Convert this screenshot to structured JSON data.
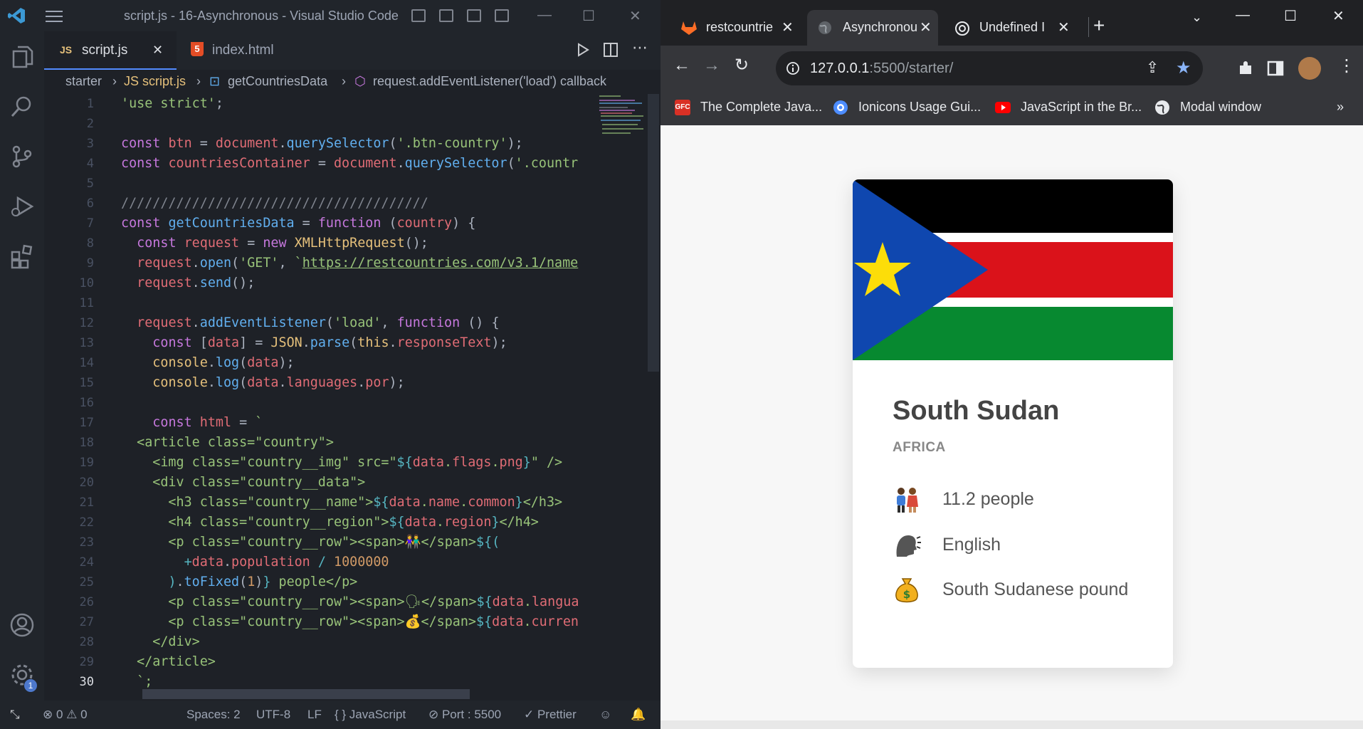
{
  "vscode": {
    "window_title": "script.js - 16-Asynchronous - Visual Studio Code",
    "tabs": [
      {
        "label": "script.js",
        "badge": "JS",
        "close": "✕"
      },
      {
        "label": "index.html",
        "badge": "5"
      }
    ],
    "breadcrumb": [
      "starter",
      "JS script.js",
      "getCountriesData",
      "request.addEventListener('load') callback"
    ],
    "line_numbers": [
      "1",
      "2",
      "3",
      "4",
      "5",
      "6",
      "7",
      "8",
      "9",
      "10",
      "11",
      "12",
      "13",
      "14",
      "15",
      "16",
      "17",
      "18",
      "19",
      "20",
      "21",
      "22",
      "23",
      "24",
      "25",
      "26",
      "27",
      "28",
      "29",
      "30"
    ],
    "statusbar": {
      "problems": "⊗ 0 ⚠ 0",
      "spaces": "Spaces: 2",
      "encoding": "UTF-8",
      "eol": "LF",
      "language": "{ } JavaScript",
      "port": "⊘ Port : 5500",
      "prettier": "✓ Prettier"
    },
    "settings_badge": "1"
  },
  "browser": {
    "tabs": [
      {
        "label": "restcountrie",
        "icon": "gitlab-icon"
      },
      {
        "label": "Asynchronou",
        "icon": "globe-icon"
      },
      {
        "label": "Undefined I",
        "icon": "chatgpt-icon"
      }
    ],
    "url_host": "127.0.0.1",
    "url_rest": ":5500/starter/",
    "bookmarks": [
      {
        "label": "The Complete Java...",
        "icon": "gfc-icon"
      },
      {
        "label": "Ionicons Usage Gui...",
        "icon": "ionicons-icon"
      },
      {
        "label": "JavaScript in the Br...",
        "icon": "youtube-icon"
      },
      {
        "label": "Modal window",
        "icon": "globe-icon"
      }
    ],
    "bookmarks_more": "»"
  },
  "country": {
    "name": "South Sudan",
    "region": "AFRICA",
    "population": "11.2 people",
    "language": "English",
    "currency": "South Sudanese pound"
  }
}
